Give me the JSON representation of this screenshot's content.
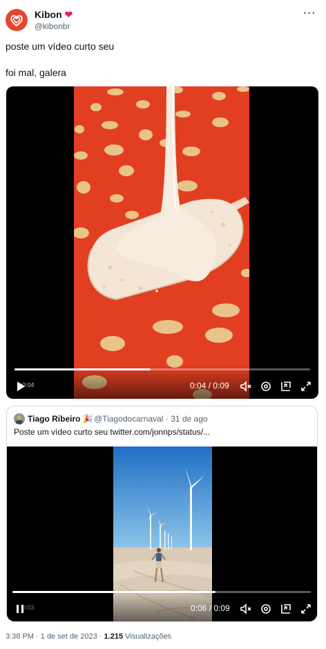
{
  "tweet": {
    "author_name": "Kibon",
    "author_handle": "@kibonbr",
    "more_glyph": "···",
    "text_line1": "poste um vídeo curto seu",
    "text_line2": "foi mal, galera"
  },
  "video1": {
    "progress_fraction": 0.46,
    "time_display": "0:04 / 0:09",
    "left_label": "0:04"
  },
  "quote": {
    "author_name": "Tiago Ribeiro",
    "author_handle": "@Tiagodocarnaval",
    "date": "31 de ago",
    "separator": "·",
    "text": "Poste um vídeo curto seu  twitter.com/jonnps/status/...",
    "video": {
      "progress_fraction": 0.68,
      "time_display": "0:06 / 0:09",
      "left_label": "0:03"
    }
  },
  "footer": {
    "time": "3:38 PM",
    "date": "1 de set de 2023",
    "views_count": "1.215",
    "views_label": "Visualizações",
    "separator": "·"
  },
  "colors": {
    "brand_red": "#e8452c",
    "heart": "#e0245e",
    "secondary_text": "#536471"
  }
}
